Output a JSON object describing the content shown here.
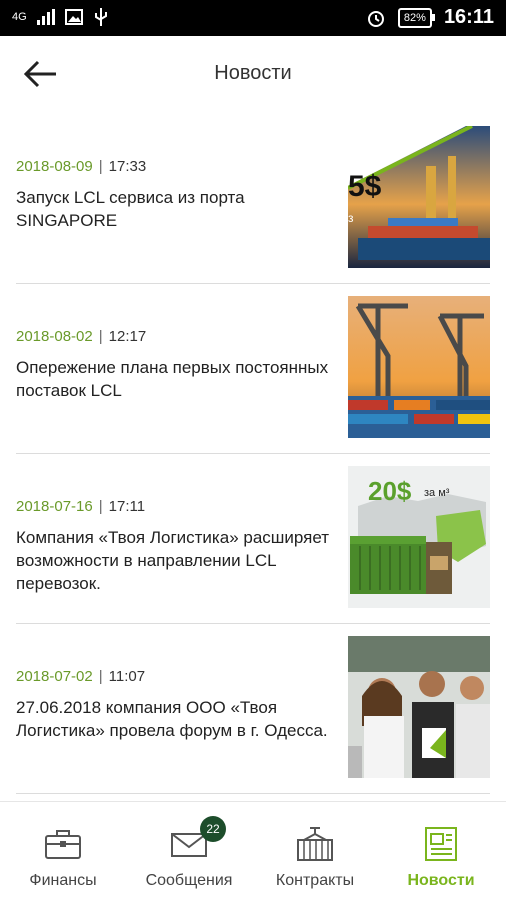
{
  "status": {
    "network": "4G",
    "battery": "82%",
    "time": "16:11"
  },
  "header": {
    "title": "Новости"
  },
  "news": [
    {
      "date": "2018-08-09",
      "time": "17:33",
      "text": "Запуск LCL сервиса из порта SINGAPORE",
      "thumb_text": "5$",
      "thumb_sub": "з"
    },
    {
      "date": "2018-08-02",
      "time": "12:17",
      "text": "Опережение плана первых постоянных поставок LCL"
    },
    {
      "date": "2018-07-16",
      "time": "17:11",
      "text": "Компания «Твоя Логистика» расширяет возможности в направлении LCL перевозок.",
      "thumb_price": "20$",
      "thumb_unit": "за м³"
    },
    {
      "date": "2018-07-02",
      "time": "11:07",
      "text": "27.06.2018 компания ООО «Твоя Логистика» провела форум в г. Одесса."
    }
  ],
  "nav": [
    {
      "label": "Финансы",
      "icon": "briefcase-icon"
    },
    {
      "label": "Сообщения",
      "icon": "mail-icon",
      "badge": "22"
    },
    {
      "label": "Контракты",
      "icon": "container-icon"
    },
    {
      "label": "Новости",
      "icon": "news-icon",
      "active": true
    }
  ],
  "colors": {
    "accent": "#7ab51d",
    "date": "#6a9a2a",
    "badge": "#1d4d2b"
  }
}
